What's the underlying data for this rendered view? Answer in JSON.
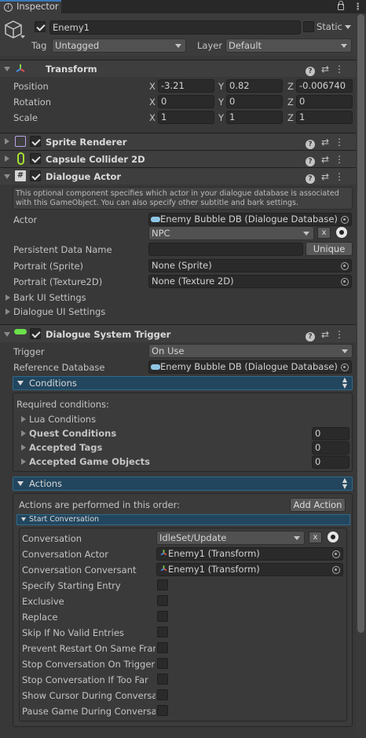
{
  "tab": {
    "label": "Inspector"
  },
  "gameobject": {
    "active": true,
    "name": "Enemy1",
    "static_label": "Static",
    "tag_label": "Tag",
    "tag_value": "Untagged",
    "layer_label": "Layer",
    "layer_value": "Default"
  },
  "transform": {
    "title": "Transform",
    "rows": [
      {
        "label": "Position",
        "x": "-3.21",
        "y": "0.82",
        "z": "-0.006740"
      },
      {
        "label": "Rotation",
        "x": "0",
        "y": "0",
        "z": "0"
      },
      {
        "label": "Scale",
        "x": "1",
        "y": "1",
        "z": "1"
      }
    ]
  },
  "components": {
    "sprite_renderer": "Sprite Renderer",
    "capsule_collider": "Capsule Collider 2D",
    "dialogue_actor": "Dialogue Actor",
    "dialogue_system_trigger": "Dialogue System Trigger"
  },
  "dialogue_actor": {
    "help": "This optional component specifies which actor in your dialogue database is associated with this GameObject. You can also specify other subtitle and bark settings.",
    "actor_label": "Actor",
    "actor_db": "Enemy Bubble DB (Dialogue Database)",
    "actor_value": "NPC",
    "persistent_label": "Persistent Data Name",
    "persistent_value": "",
    "unique_label": "Unique",
    "portrait_sprite_label": "Portrait (Sprite)",
    "portrait_sprite_value": "None (Sprite)",
    "portrait_tex_label": "Portrait (Texture2D)",
    "portrait_tex_value": "None (Texture 2D)",
    "bark_ui": "Bark UI Settings",
    "dialogue_ui": "Dialogue UI Settings"
  },
  "trigger": {
    "trigger_label": "Trigger",
    "trigger_value": "On Use",
    "refdb_label": "Reference Database",
    "refdb_value": "Enemy Bubble DB (Dialogue Database)",
    "conditions_title": "Conditions",
    "required": "Required conditions:",
    "lua": "Lua Conditions",
    "quest": "Quest Conditions",
    "quest_value": "0",
    "tags": "Accepted Tags",
    "tags_value": "0",
    "gameobjects": "Accepted Game Objects",
    "gameobjects_value": "0",
    "actions_title": "Actions",
    "actions_order": "Actions are performed in this order:",
    "add_action": "Add Action",
    "start_conversation": "Start Conversation",
    "conv_label": "Conversation",
    "conv_value": "IdleSet/Update",
    "conv_actor_label": "Conversation Actor",
    "conv_actor_value": "Enemy1 (Transform)",
    "conv_conversant_label": "Conversation Conversant",
    "conv_conversant_value": "Enemy1 (Transform)",
    "options": [
      "Specify Starting Entry",
      "Exclusive",
      "Replace",
      "Skip If No Valid Entries",
      "Prevent Restart On Same Fram",
      "Stop Conversation On Trigger",
      "Stop Conversation If Too Far",
      "Show Cursor During Conversat",
      "Pause Game During Conversat"
    ]
  },
  "colors": {
    "accent_blue": "#22465e",
    "capsule_green": "#a6e22e"
  },
  "icons": [
    "lock-icon",
    "kebab-menu-icon",
    "cube-icon",
    "transform-icon",
    "sprite-renderer-icon",
    "capsule-collider-icon",
    "script-icon",
    "help-icon",
    "presets-icon",
    "object-picker-icon",
    "dialogue-database-icon"
  ]
}
